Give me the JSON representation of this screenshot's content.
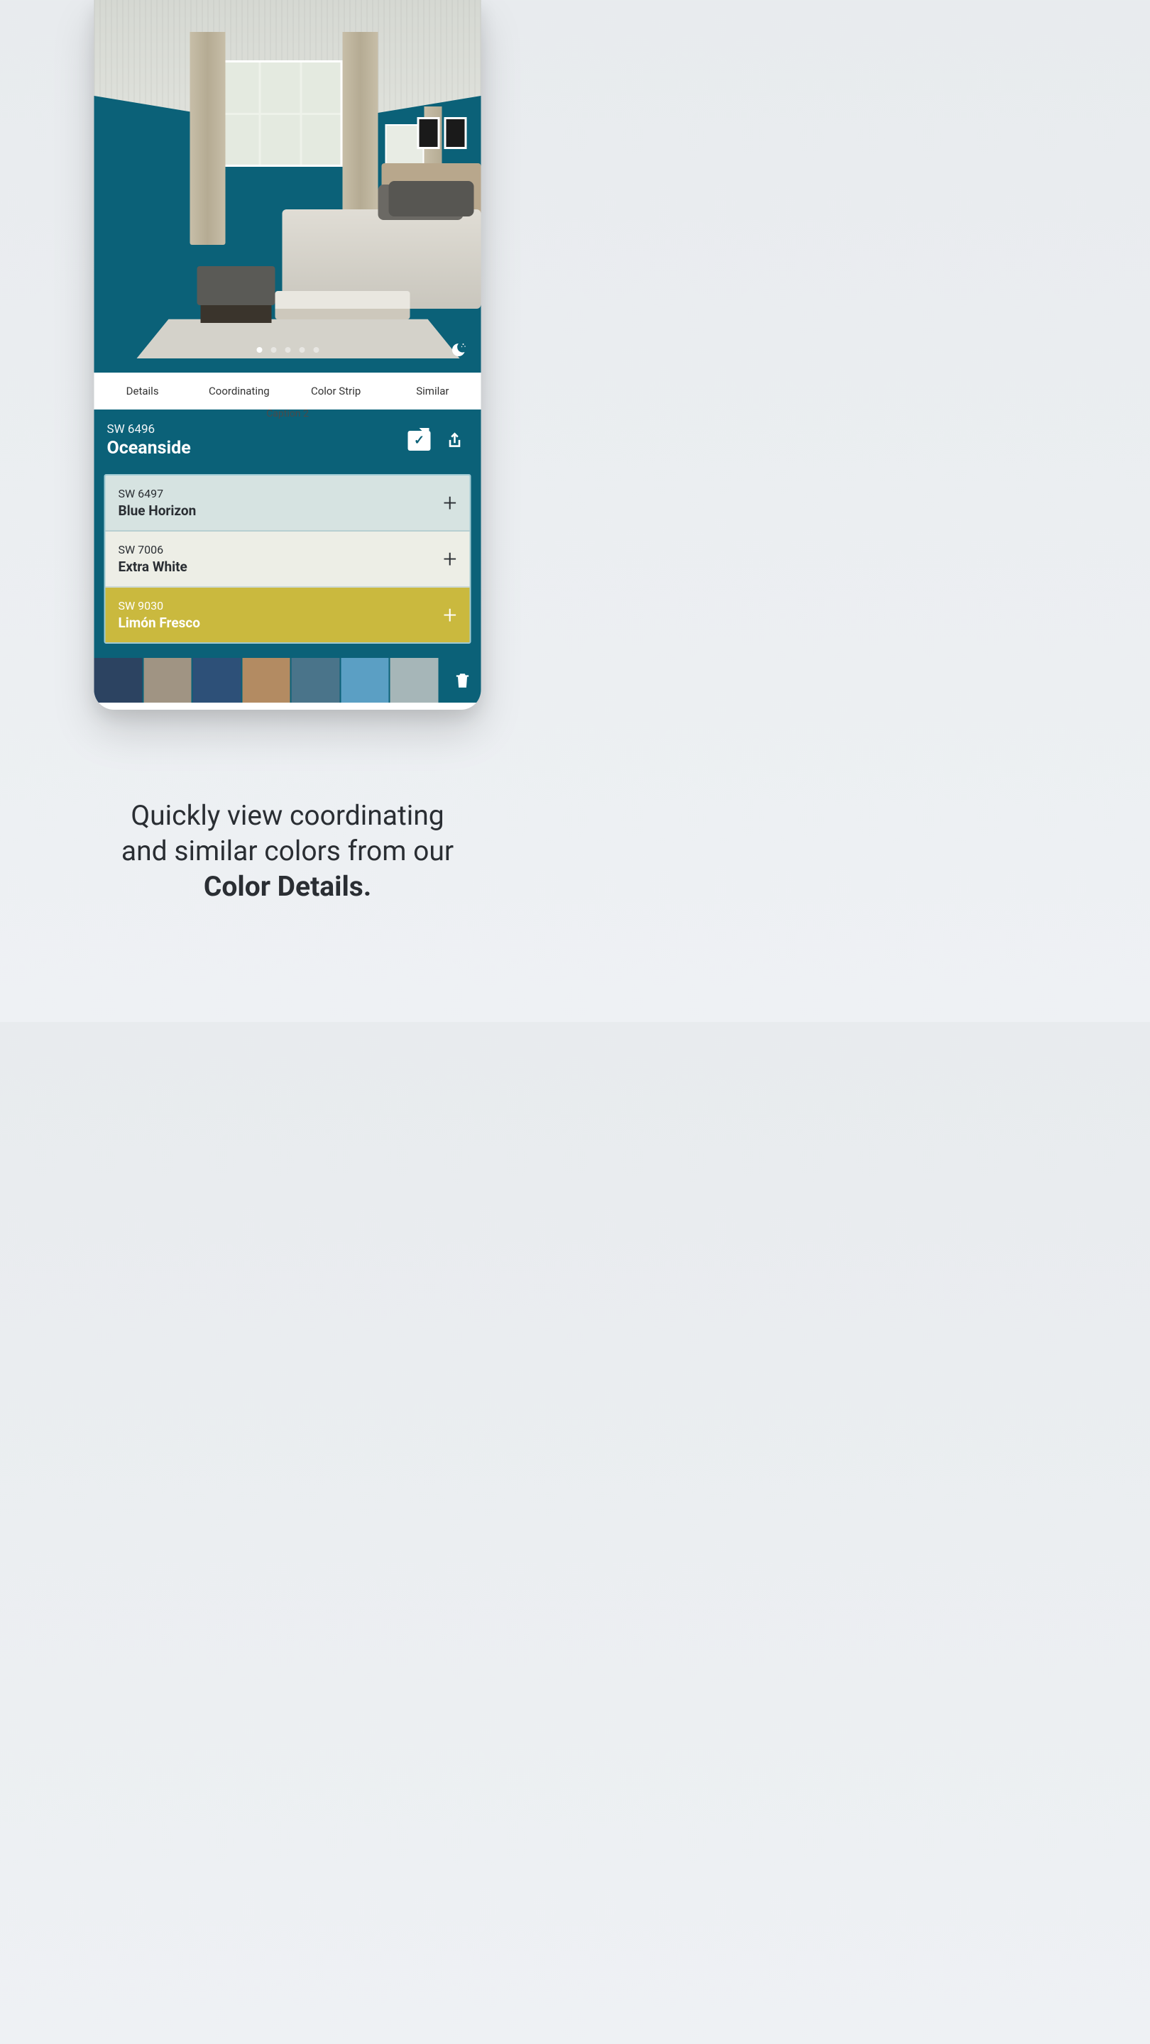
{
  "tabs": [
    "Details",
    "Coordinating",
    "Color Strip",
    "Similar"
  ],
  "caption_debug": "Caption 2",
  "current_color": {
    "code": "SW 6496",
    "name": "Oceanside",
    "hex": "#0b6178"
  },
  "carousel": {
    "count": 5,
    "active": 0
  },
  "coordinating": [
    {
      "code": "SW 6497",
      "name": "Blue Horizon",
      "bg": "#d6e3e1",
      "fg": "#2a2e33",
      "plus_fg": "#2a2e33"
    },
    {
      "code": "SW 7006",
      "name": "Extra White",
      "bg": "#edeee6",
      "fg": "#2a2e33",
      "plus_fg": "#2a2e33"
    },
    {
      "code": "SW 9030",
      "name": "Limón Fresco",
      "bg": "#cab93e",
      "fg": "#ffffff",
      "plus_fg": "#ffffff"
    }
  ],
  "palette": [
    "#2c4361",
    "#a09483",
    "#2d5078",
    "#b38b62",
    "#4a748a",
    "#5b9fc4",
    "#a6b6b8"
  ],
  "promo": {
    "line1": "Quickly view coordinating",
    "line2": "and similar colors from our",
    "line3_bold": "Color Details."
  }
}
